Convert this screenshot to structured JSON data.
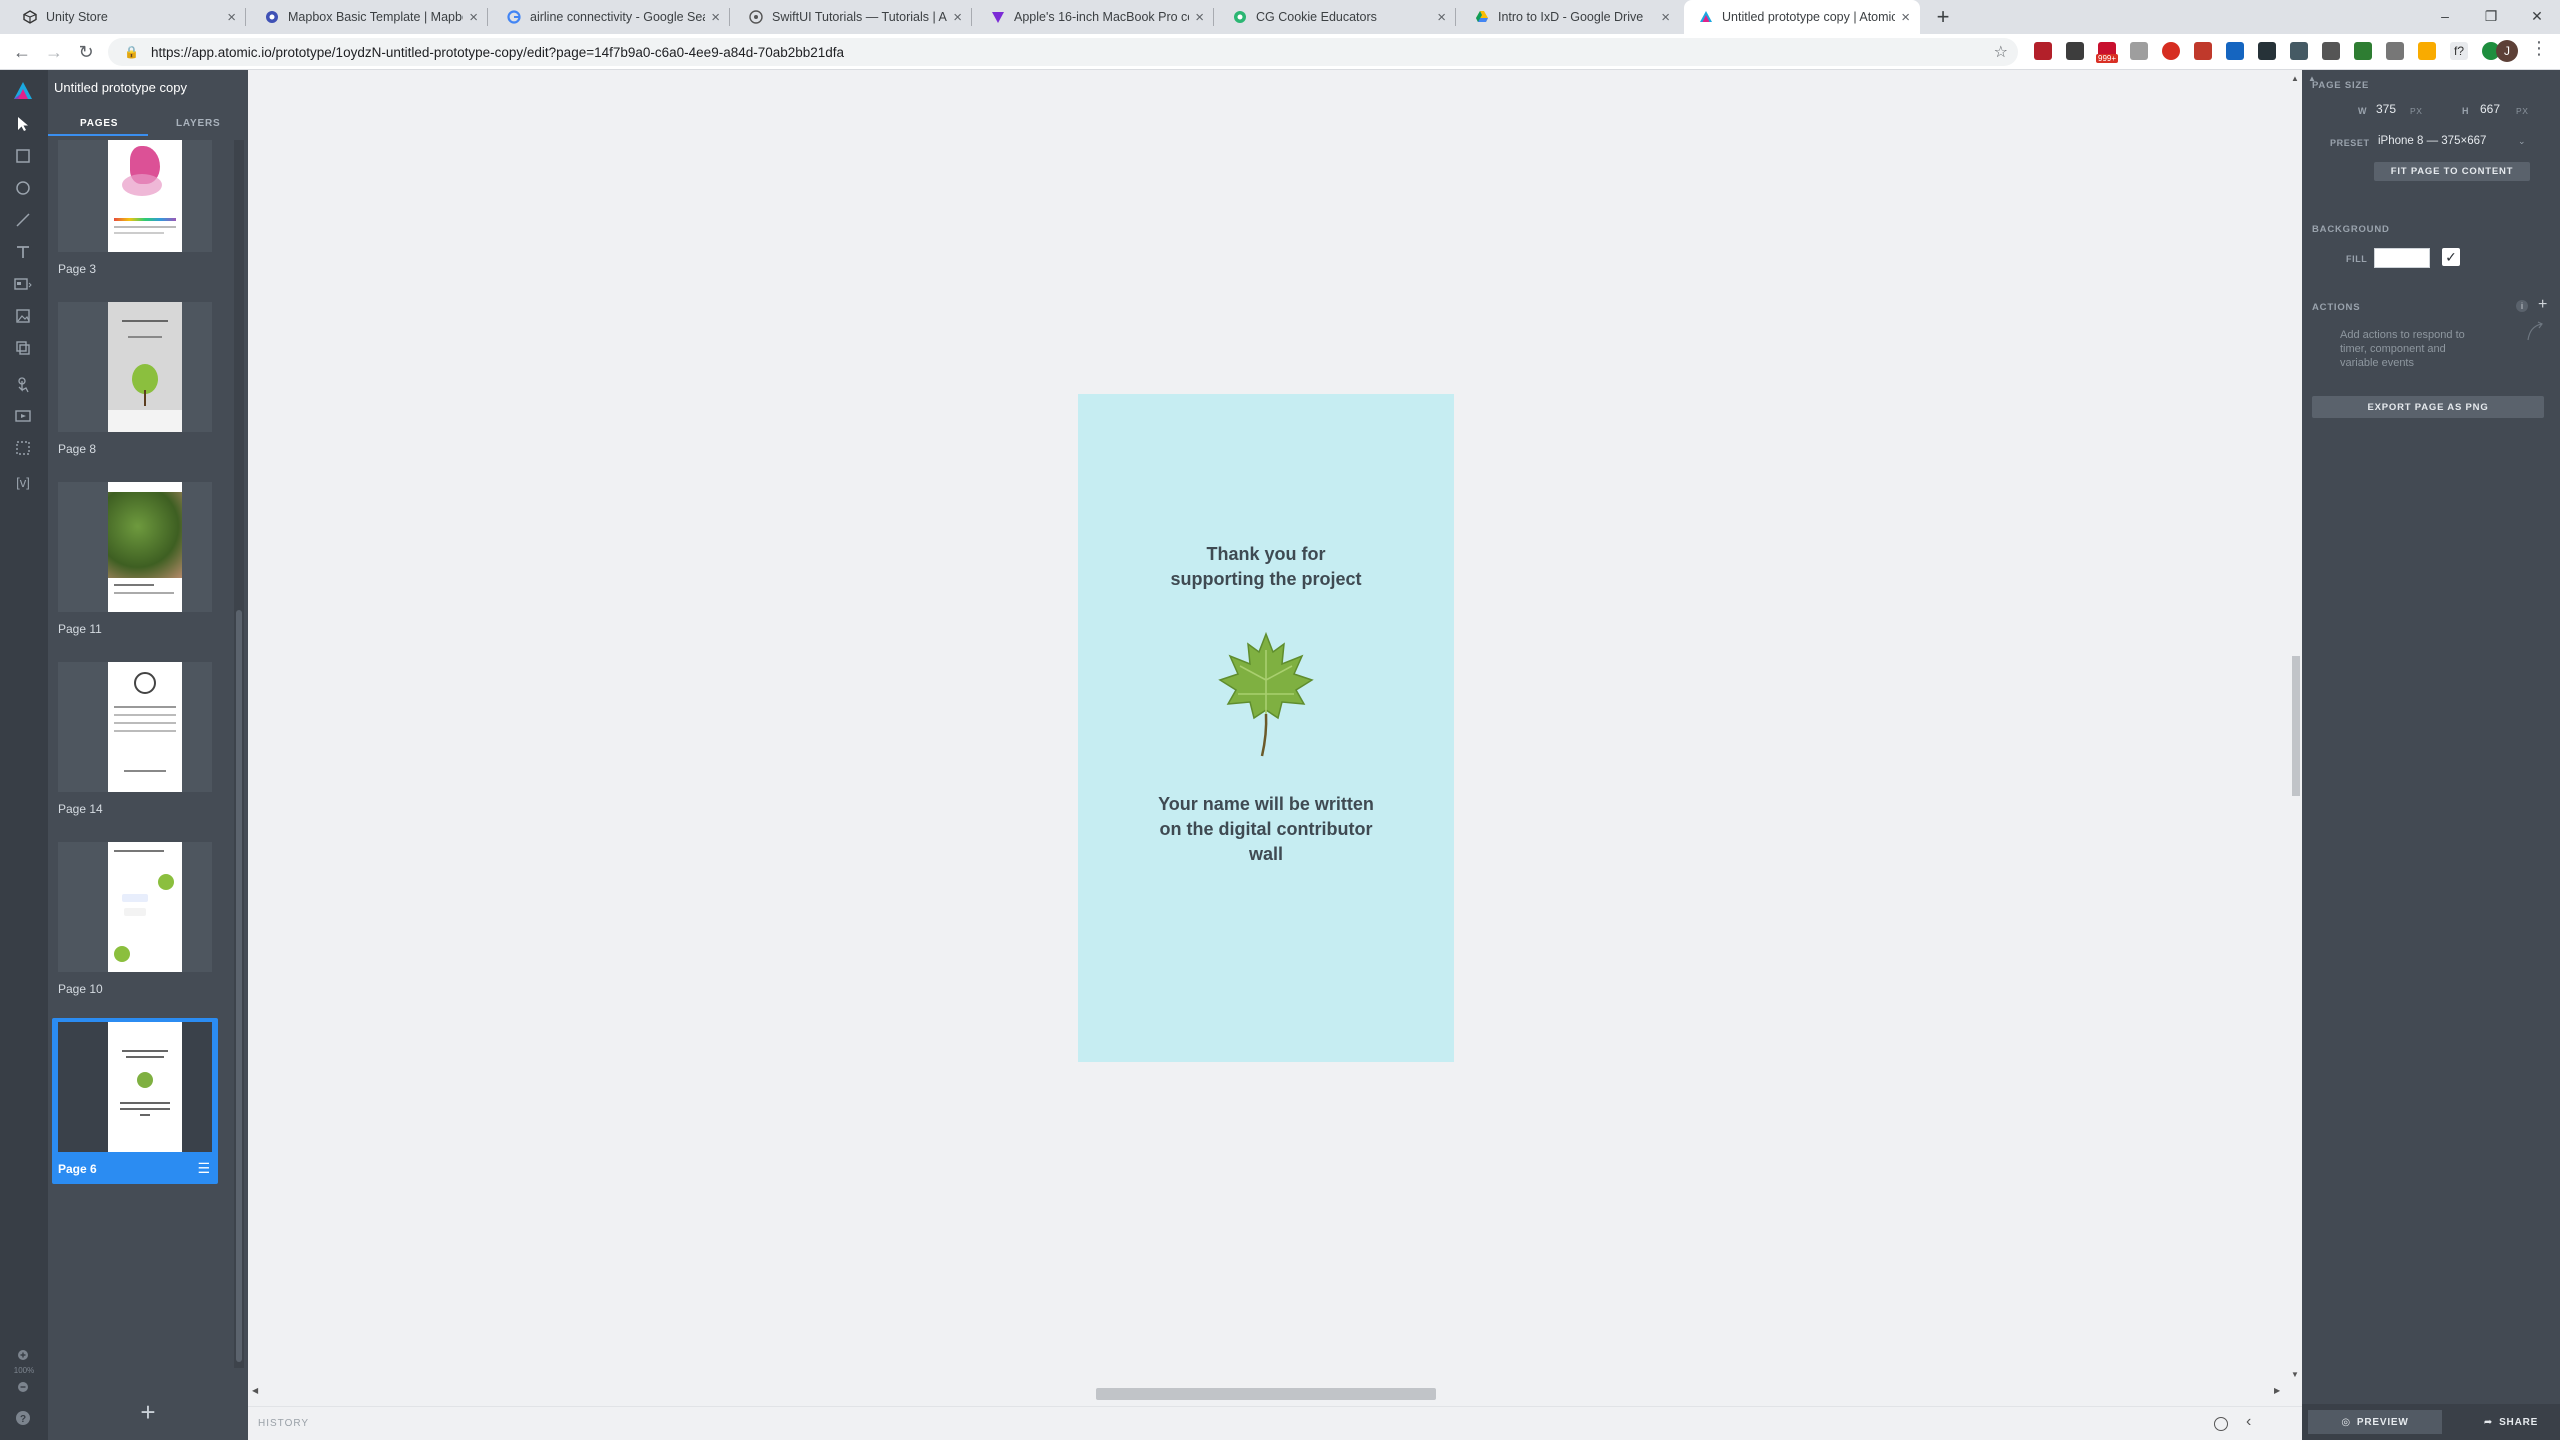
{
  "browser": {
    "tabs": [
      {
        "title": "Unity Store",
        "icon": "unity-icon"
      },
      {
        "title": "Mapbox Basic Template | Mapbo",
        "icon": "mapbox-icon"
      },
      {
        "title": "airline connectivity - Google Sea",
        "icon": "google-icon"
      },
      {
        "title": "SwiftUI Tutorials — Tutorials | Ap",
        "icon": "swiftui-icon"
      },
      {
        "title": "Apple's 16-inch MacBook Pro co",
        "icon": "verge-icon"
      },
      {
        "title": "CG Cookie Educators",
        "icon": "cgcookie-icon"
      },
      {
        "title": "Intro to IxD - Google Drive",
        "icon": "drive-icon"
      },
      {
        "title": "Untitled prototype copy | Atomic",
        "icon": "atomic-icon",
        "active": true
      }
    ],
    "new_tab": "+",
    "url": "https://app.atomic.io/prototype/1oydzN-untitled-prototype-copy/edit?page=14f7b9a0-c6a0-4ee9-a84d-70ab2bb21dfa",
    "window_controls": [
      "–",
      "❐",
      "✕"
    ],
    "profile_initial": "J",
    "badge_999": "999+"
  },
  "app": {
    "project_title": "Untitled prototype copy",
    "panel_tabs": {
      "pages": "PAGES",
      "layers": "LAYERS"
    },
    "pages": [
      {
        "label": "Page 3"
      },
      {
        "label": "Page 8"
      },
      {
        "label": "Page 11"
      },
      {
        "label": "Page 14"
      },
      {
        "label": "Page 10"
      },
      {
        "label": "Page 6",
        "selected": true
      }
    ],
    "add_page": "+",
    "history_label": "HISTORY",
    "zoom_label": "100%",
    "artboard": {
      "background": "#c6edf2",
      "heading_line1": "Thank you for",
      "heading_line2": "supporting the project",
      "message_line1": "Your name will be written",
      "message_line2": "on the digital contributor",
      "message_line3": "wall"
    },
    "properties": {
      "page_size_title": "PAGE SIZE",
      "w_label": "W",
      "w_value": "375",
      "w_unit": "PX",
      "h_label": "H",
      "h_value": "667",
      "h_unit": "PX",
      "preset_label": "PRESET",
      "preset_value": "iPhone 8 — 375×667",
      "fit_button": "FIT PAGE TO CONTENT",
      "background_title": "BACKGROUND",
      "fill_label": "FILL",
      "fill_color": "#ffffff",
      "fill_checked": true,
      "actions_title": "ACTIONS",
      "actions_hint": "Add actions to respond to timer, component and variable events",
      "export_button": "EXPORT PAGE AS PNG",
      "preview_button": "PREVIEW",
      "share_button": "SHARE"
    },
    "accent": "#2b8cf2"
  }
}
